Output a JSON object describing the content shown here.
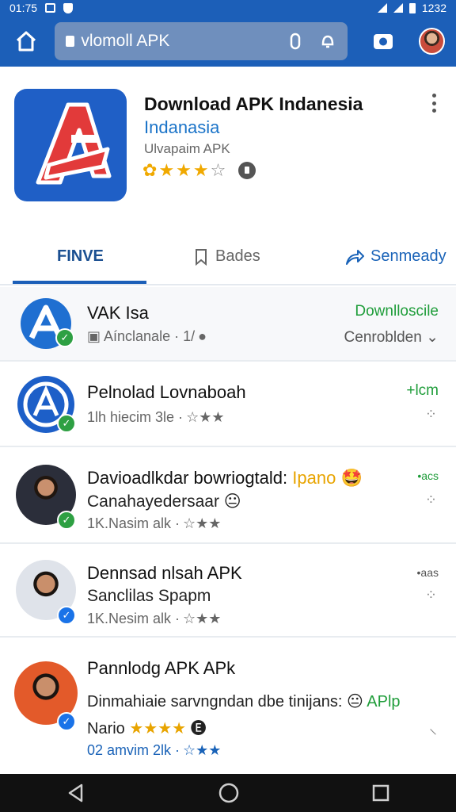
{
  "status_bar": {
    "time": "01:75",
    "battery": "1232"
  },
  "search": {
    "value": "vlomoll APK"
  },
  "app": {
    "title": "Download APK Indanesia",
    "developer": "Indanasia",
    "subtitle": "Ulvapaim APK",
    "rating_stars": 3,
    "rating_max": 5
  },
  "tabs": [
    {
      "label": "FINVE",
      "active": true
    },
    {
      "label": "Bades",
      "active": false
    },
    {
      "label": "Senmeady",
      "active": false
    }
  ],
  "list": [
    {
      "title": "VAK Isa",
      "meta": "Aínclanale · 1/",
      "action": "Downlloscile",
      "secondary": "Cenroblden"
    },
    {
      "title": "Pelnolad Lovnaboah",
      "meta": "1lh hiecim 3le ·",
      "action": "+lcm"
    },
    {
      "title": "Davioadlkdar bowriogtald:",
      "title_suffix": "Ipano",
      "line2": "Canahayedersaar",
      "meta": "1K.Nasim alk ·",
      "action": "•acs"
    },
    {
      "title": "Dennsad nlsah APK",
      "line2": "Sanclilas Spapm",
      "meta": "1K.Nesim alk ·",
      "action": "•aas"
    },
    {
      "title": "Pannlodg APK APk",
      "line2": "Dinmahiaie sarvngndan dbe tinijans:",
      "line2_suffix": "APlp",
      "line3": "Nario",
      "meta": "02 amvim 2lk ·"
    }
  ],
  "icons": {
    "home": "home-icon",
    "camera": "camera-icon",
    "more": "more-vert-icon",
    "bookmark": "bookmark-icon",
    "share": "share-icon",
    "back": "back-icon",
    "home_nav": "home-nav-icon",
    "recents": "recents-icon"
  },
  "colors": {
    "primary": "#1c5fb8",
    "accent_green": "#1f9d3a",
    "star": "#f0a900"
  }
}
